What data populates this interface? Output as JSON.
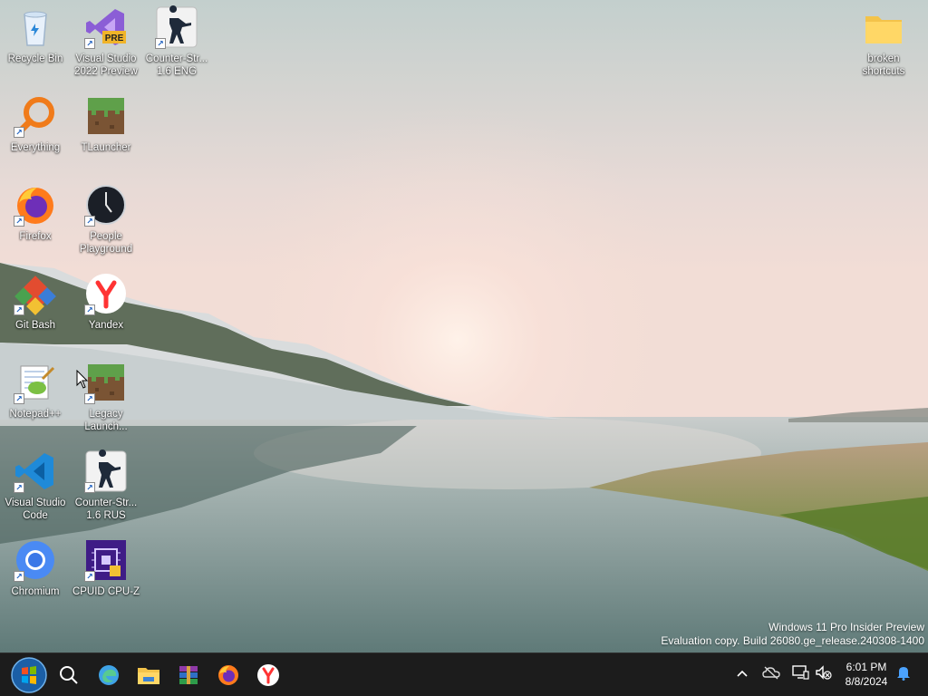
{
  "desktop": {
    "icons": [
      {
        "label": "Recycle Bin",
        "icon": "recycle-bin-icon",
        "shortcut": false
      },
      {
        "label": "Visual Studio 2022 Preview",
        "icon": "visual-studio-preview-icon",
        "shortcut": true,
        "badge": "PRE"
      },
      {
        "label": "Counter-Str... 1.6 ENG",
        "icon": "counter-strike-icon",
        "shortcut": true
      },
      {
        "label": "Everything",
        "icon": "everything-search-icon",
        "shortcut": true
      },
      {
        "label": "TLauncher",
        "icon": "minecraft-grass-block-icon",
        "shortcut": true
      },
      {
        "label": "Firefox",
        "icon": "firefox-icon",
        "shortcut": true
      },
      {
        "label": "People Playground",
        "icon": "people-playground-icon",
        "shortcut": true
      },
      {
        "label": "Git Bash",
        "icon": "git-bash-icon",
        "shortcut": true
      },
      {
        "label": "Yandex",
        "icon": "yandex-browser-icon",
        "shortcut": true
      },
      {
        "label": "Notepad++",
        "icon": "notepad-plus-plus-icon",
        "shortcut": true
      },
      {
        "label": "Legacy Launch...",
        "icon": "minecraft-grass-block-icon",
        "shortcut": true
      },
      {
        "label": "Visual Studio Code",
        "icon": "vscode-icon",
        "shortcut": true
      },
      {
        "label": "Counter-Str... 1.6 RUS",
        "icon": "counter-strike-icon",
        "shortcut": true
      },
      {
        "label": "Chromium",
        "icon": "chromium-icon",
        "shortcut": true
      },
      {
        "label": "CPUID CPU-Z",
        "icon": "cpu-z-icon",
        "shortcut": true
      },
      {
        "label": "broken shortcuts",
        "icon": "folder-icon",
        "shortcut": false
      }
    ]
  },
  "watermark": {
    "line1": "Windows 11 Pro Insider Preview",
    "line2": "Evaluation copy. Build 26080.ge_release.240308-1400"
  },
  "taskbar": {
    "start": "windows-7-start-orb-icon",
    "pinned": [
      "search-icon",
      "edge-browser-icon",
      "file-explorer-icon",
      "winrar-icon",
      "firefox-icon",
      "yandex-browser-icon"
    ],
    "tray": [
      "chevron-up-icon",
      "onedrive-offline-icon",
      "network-icon",
      "volume-muted-icon",
      "notification-bell-icon"
    ],
    "clock": {
      "time": "6:01 PM",
      "date": "8/8/2024"
    }
  },
  "colors": {
    "taskbar": "#1c1c1c",
    "sky_top": "#c6d1cf",
    "sky_glow": "#f4ddd5",
    "water": "#7e9794",
    "accent": "#2b88d8"
  }
}
